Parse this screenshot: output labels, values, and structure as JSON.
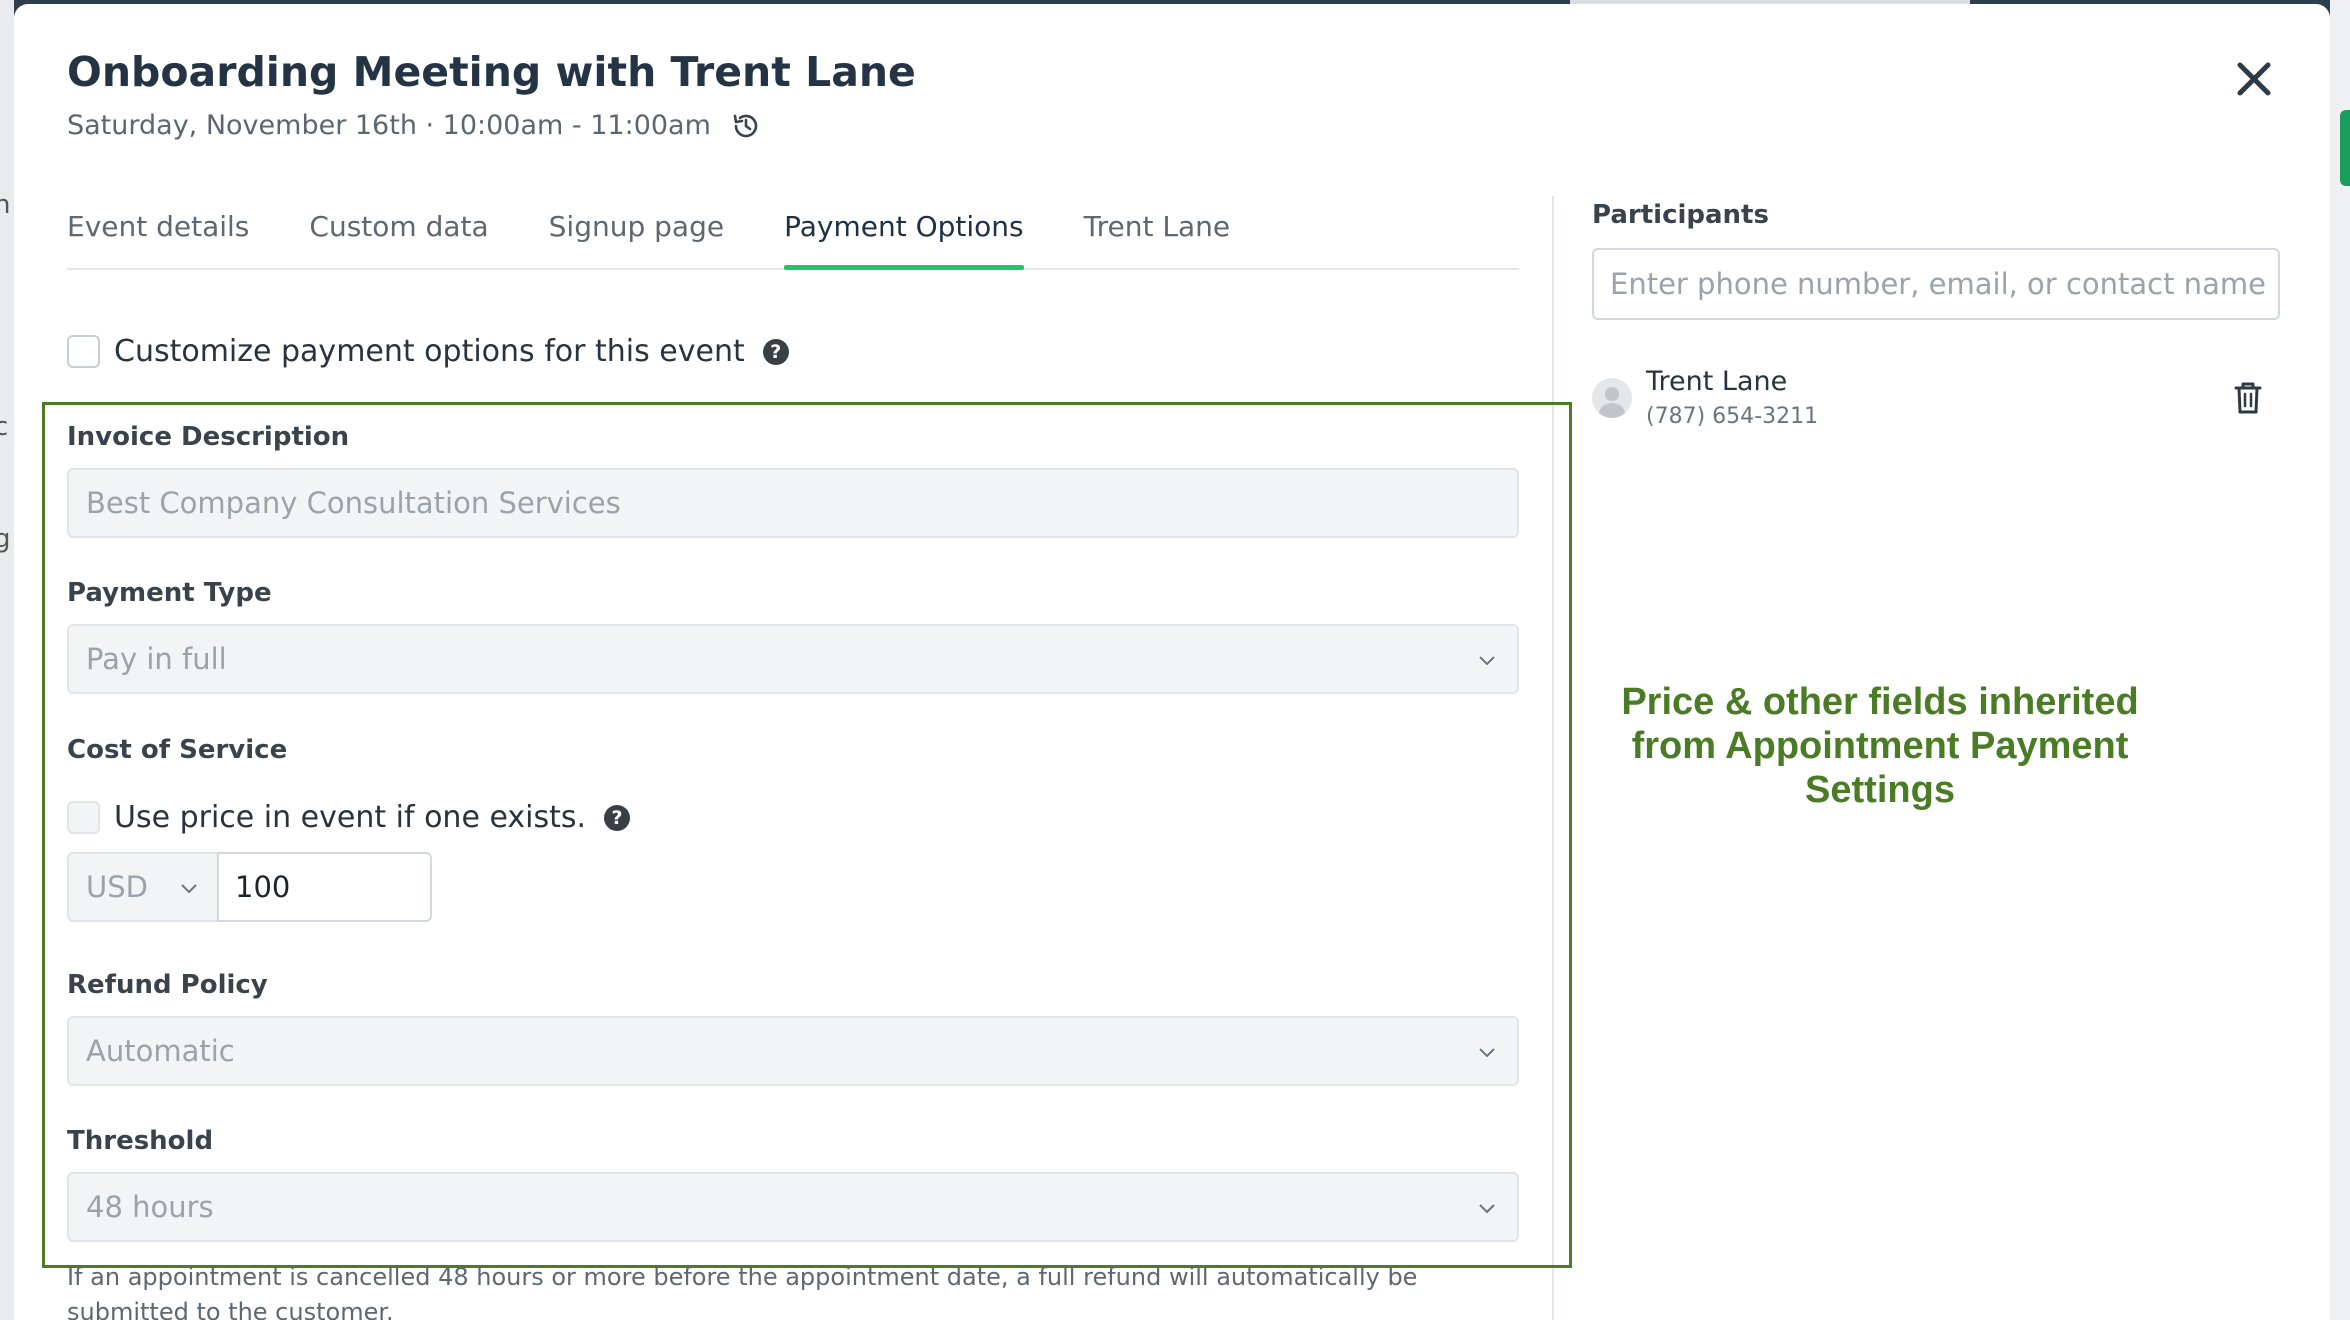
{
  "background": {
    "left_fragments": [
      "n",
      "c",
      "g"
    ]
  },
  "modal": {
    "title": "Onboarding Meeting with Trent Lane",
    "subtitle": "Saturday, November 16th · 10:00am - 11:00am",
    "close_icon": "close-icon",
    "history_icon": "history-clock-icon"
  },
  "tabs": [
    {
      "label": "Event details",
      "active": false
    },
    {
      "label": "Custom data",
      "active": false
    },
    {
      "label": "Signup page",
      "active": false
    },
    {
      "label": "Payment Options",
      "active": true
    },
    {
      "label": "Trent Lane",
      "active": false
    }
  ],
  "payment": {
    "customize_label": "Customize payment options for this event",
    "customize_checked": false,
    "invoice": {
      "label": "Invoice Description",
      "value": "Best Company Consultation Services"
    },
    "payment_type": {
      "label": "Payment Type",
      "value": "Pay in full"
    },
    "cost": {
      "label": "Cost of Service",
      "use_price_label": "Use price in event if one exists.",
      "use_price_checked": false,
      "currency": "USD",
      "amount": "100"
    },
    "refund": {
      "label": "Refund Policy",
      "value": "Automatic"
    },
    "threshold": {
      "label": "Threshold",
      "value": "48 hours"
    },
    "refund_note": "If an appointment is cancelled 48 hours or more before the appointment date, a full refund will automatically be submitted to the customer."
  },
  "participants": {
    "title": "Participants",
    "search_placeholder": "Enter phone number, email, or contact name",
    "list": [
      {
        "name": "Trent Lane",
        "phone": "(787) 654-3211"
      }
    ]
  },
  "annotation": {
    "lines": [
      "Price & other fields inherited",
      "from Appointment Payment",
      "Settings"
    ],
    "color": "#4a7c26"
  },
  "colors": {
    "accent": "#25c26e",
    "annotation_box": "#4a7c26",
    "title": "#243445"
  }
}
